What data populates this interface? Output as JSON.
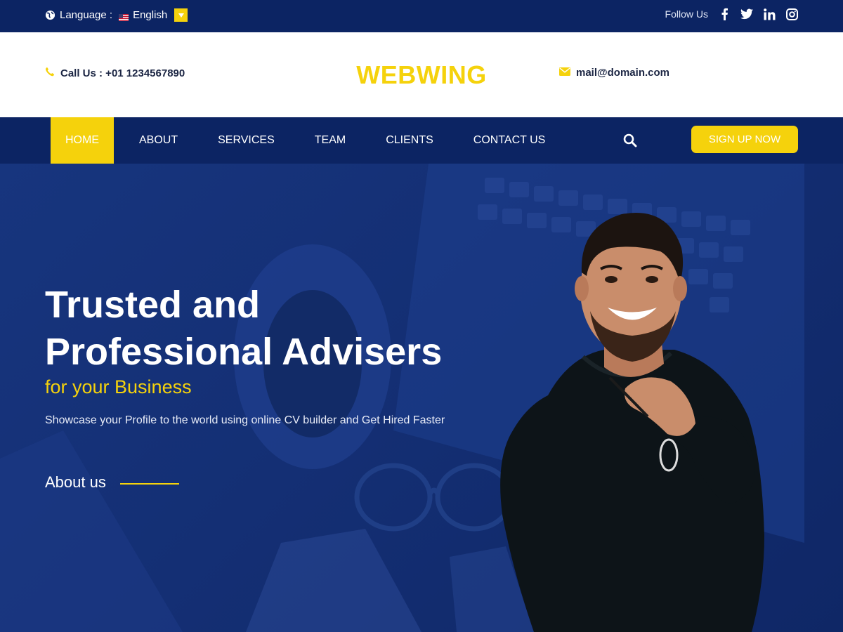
{
  "topbar": {
    "language_label": "Language :",
    "language_value": "English",
    "follow_label": "Follow Us",
    "social_icons": [
      "facebook-icon",
      "twitter-icon",
      "linkedin-icon",
      "instagram-icon"
    ]
  },
  "header": {
    "call": "Call Us : +01 1234567890",
    "logo": "WEBWING",
    "email": "mail@domain.com"
  },
  "nav": {
    "items": [
      {
        "label": "HOME",
        "active": true
      },
      {
        "label": "ABOUT",
        "active": false
      },
      {
        "label": "SERVICES",
        "active": false
      },
      {
        "label": "TEAM",
        "active": false
      },
      {
        "label": "CLIENTS",
        "active": false
      },
      {
        "label": "CONTACT US",
        "active": false
      }
    ],
    "signup": "SIGN UP NOW"
  },
  "hero": {
    "headline_line1": "Trusted and",
    "headline_line2": "Professional Advisers",
    "subheadline": "for your Business",
    "description": "Showcase your Profile to the world using online CV builder and Get Hired Faster",
    "about_link": "About us"
  },
  "colors": {
    "navy": "#0c2463",
    "accent": "#f5d20c",
    "hero_bg": "#142f74",
    "white": "#ffffff"
  }
}
